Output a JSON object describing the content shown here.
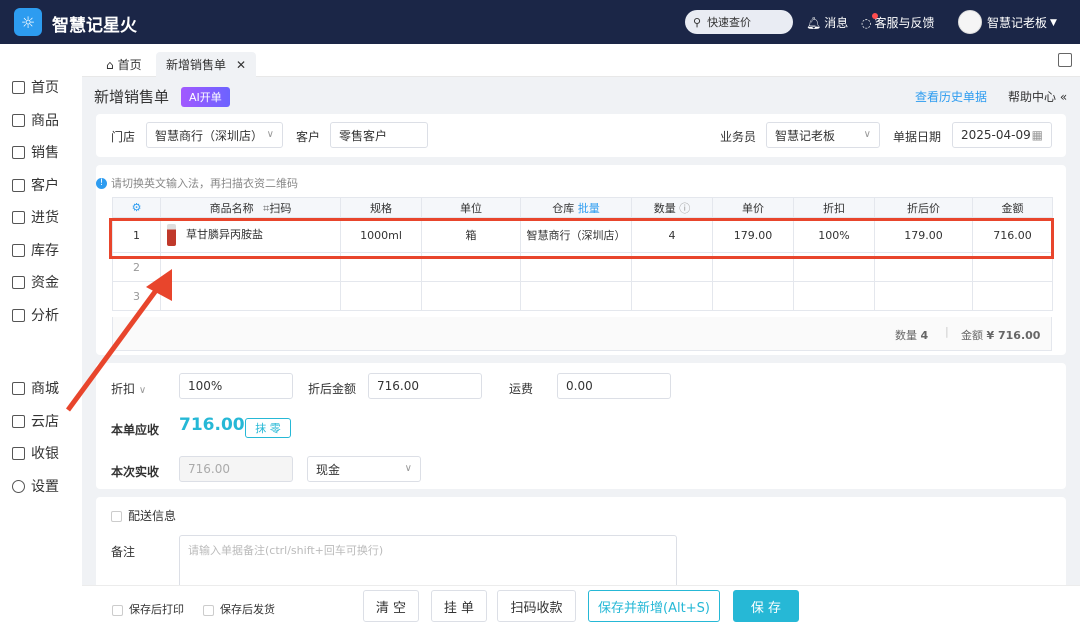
{
  "app": {
    "title": "智慧记星火",
    "logo_text": "星火"
  },
  "topbar": {
    "search": "快速查价",
    "messages": "消息",
    "service": "客服与反馈",
    "user": "智慧记老板"
  },
  "sidebar": {
    "items": [
      {
        "label": "首页",
        "icon": "home-icon"
      },
      {
        "label": "商品",
        "icon": "goods-icon"
      },
      {
        "label": "销售",
        "icon": "sales-icon"
      },
      {
        "label": "客户",
        "icon": "customer-icon"
      },
      {
        "label": "进货",
        "icon": "purchase-icon"
      },
      {
        "label": "库存",
        "icon": "stock-icon"
      },
      {
        "label": "资金",
        "icon": "fund-icon"
      },
      {
        "label": "分析",
        "icon": "analysis-icon"
      },
      {
        "label": "商城",
        "icon": "mall-icon"
      },
      {
        "label": "云店",
        "icon": "cloud-store-icon"
      },
      {
        "label": "收银",
        "icon": "cashier-icon"
      },
      {
        "label": "设置",
        "icon": "settings-icon"
      }
    ]
  },
  "tabs": [
    {
      "label": "首页"
    },
    {
      "label": "新增销售单"
    }
  ],
  "page": {
    "title": "新增销售单",
    "ai_badge": "AI开单",
    "history_link": "查看历史单据",
    "help": "帮助中心"
  },
  "header_form": {
    "store_label": "门店",
    "store_value": "智慧商行（深圳店）",
    "customer_label": "客户",
    "customer_value": "零售客户",
    "salesman_label": "业务员",
    "salesman_value": "智慧记老板",
    "date_label": "单据日期",
    "date_value": "2025-04-09"
  },
  "table": {
    "hint": "请切换英文输入法，再扫描衣资二维码",
    "headers": {
      "name": "商品名称",
      "scan": "扫码",
      "spec": "规格",
      "unit": "单位",
      "warehouse": "仓库",
      "batch": "批量",
      "qty": "数量",
      "price": "单价",
      "discount": "折扣",
      "discounted_price": "折后价",
      "amount": "金额"
    },
    "rows": [
      {
        "no": "1",
        "name": "草甘膦异丙胺盐",
        "spec": "1000ml",
        "unit": "箱",
        "warehouse": "智慧商行（深圳店）",
        "qty": "4",
        "price": "179.00",
        "discount": "100%",
        "discounted_price": "179.00",
        "amount": "716.00"
      },
      {
        "no": "2",
        "name": "",
        "spec": "",
        "unit": "",
        "warehouse": "",
        "qty": "",
        "price": "",
        "discount": "",
        "discounted_price": "",
        "amount": ""
      },
      {
        "no": "3",
        "name": "",
        "spec": "",
        "unit": "",
        "warehouse": "",
        "qty": "",
        "price": "",
        "discount": "",
        "discounted_price": "",
        "amount": ""
      }
    ],
    "summary": {
      "qty_label": "数量",
      "qty": "4",
      "amount_label": "金额",
      "amount": "¥ 716.00"
    }
  },
  "settlement": {
    "discount_label": "折扣",
    "discount_value": "100%",
    "after_label": "折后金额",
    "after_value": "716.00",
    "freight_label": "运费",
    "freight_value": "0.00",
    "due_label": "本单应收",
    "due_value": "716.00",
    "round_btn": "抹 零",
    "paid_label": "本次实收",
    "paid_value": "716.00",
    "pay_method": "现金"
  },
  "delivery": {
    "label": "配送信息",
    "remark_label": "备注",
    "remark_placeholder": "请输入单据备注(ctrl/shift+回车可换行)"
  },
  "footer": {
    "print_after_save": "保存后打印",
    "ship_after_save": "保存后发货",
    "clear": "清 空",
    "hold": "挂 单",
    "scan_pay": "扫码收款",
    "save_new": "保存并新增(Alt+S)",
    "save": "保 存"
  },
  "colors": {
    "accent": "#26b8d6",
    "topbar": "#1b2647",
    "highlight": "#e8452c",
    "link": "#2d9cf0"
  }
}
